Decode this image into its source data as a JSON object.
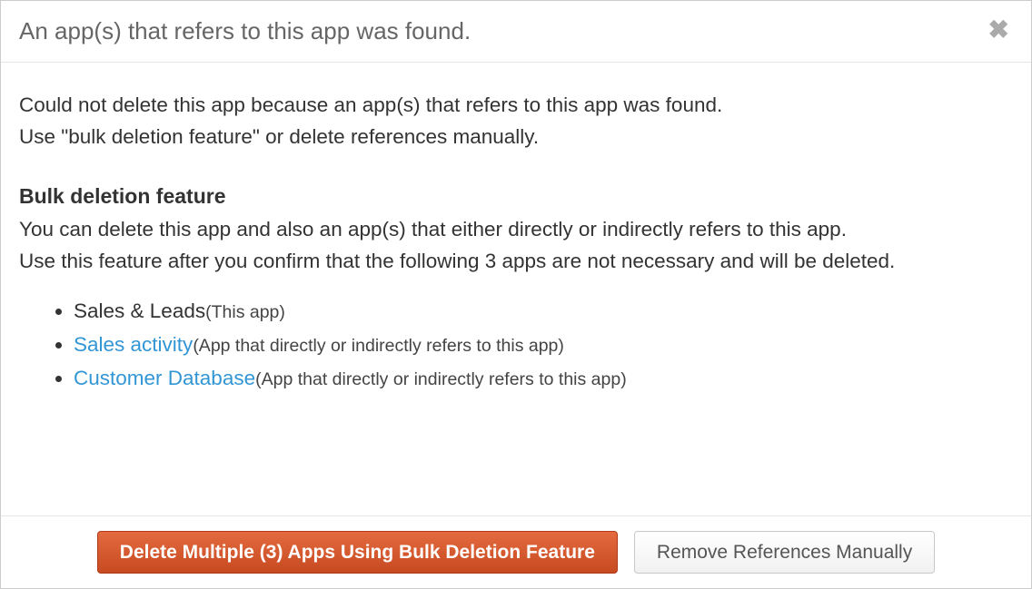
{
  "dialog": {
    "title": "An app(s) that refers to this app was found.",
    "intro_line1": "Could not delete this app because an app(s) that refers to this app was found.",
    "intro_line2": "Use \"bulk deletion feature\" or delete references manually.",
    "section_heading": "Bulk deletion feature",
    "section_desc_line1": "You can delete this app and also an app(s) that either directly or indirectly refers to this app.",
    "section_desc_line2": "Use this feature after you confirm that the following 3 apps are not necessary and will be deleted.",
    "apps": [
      {
        "name": "Sales & Leads",
        "note": "(This app)",
        "is_link": false
      },
      {
        "name": "Sales activity",
        "note": "(App that directly or indirectly refers to this app)",
        "is_link": true
      },
      {
        "name": "Customer Database",
        "note": "(App that directly or indirectly refers to this app)",
        "is_link": true
      }
    ],
    "primary_button": "Delete Multiple (3) Apps Using Bulk Deletion Feature",
    "secondary_button": "Remove References Manually"
  },
  "colors": {
    "link": "#3296d5",
    "primary_btn": "#d5542b"
  }
}
